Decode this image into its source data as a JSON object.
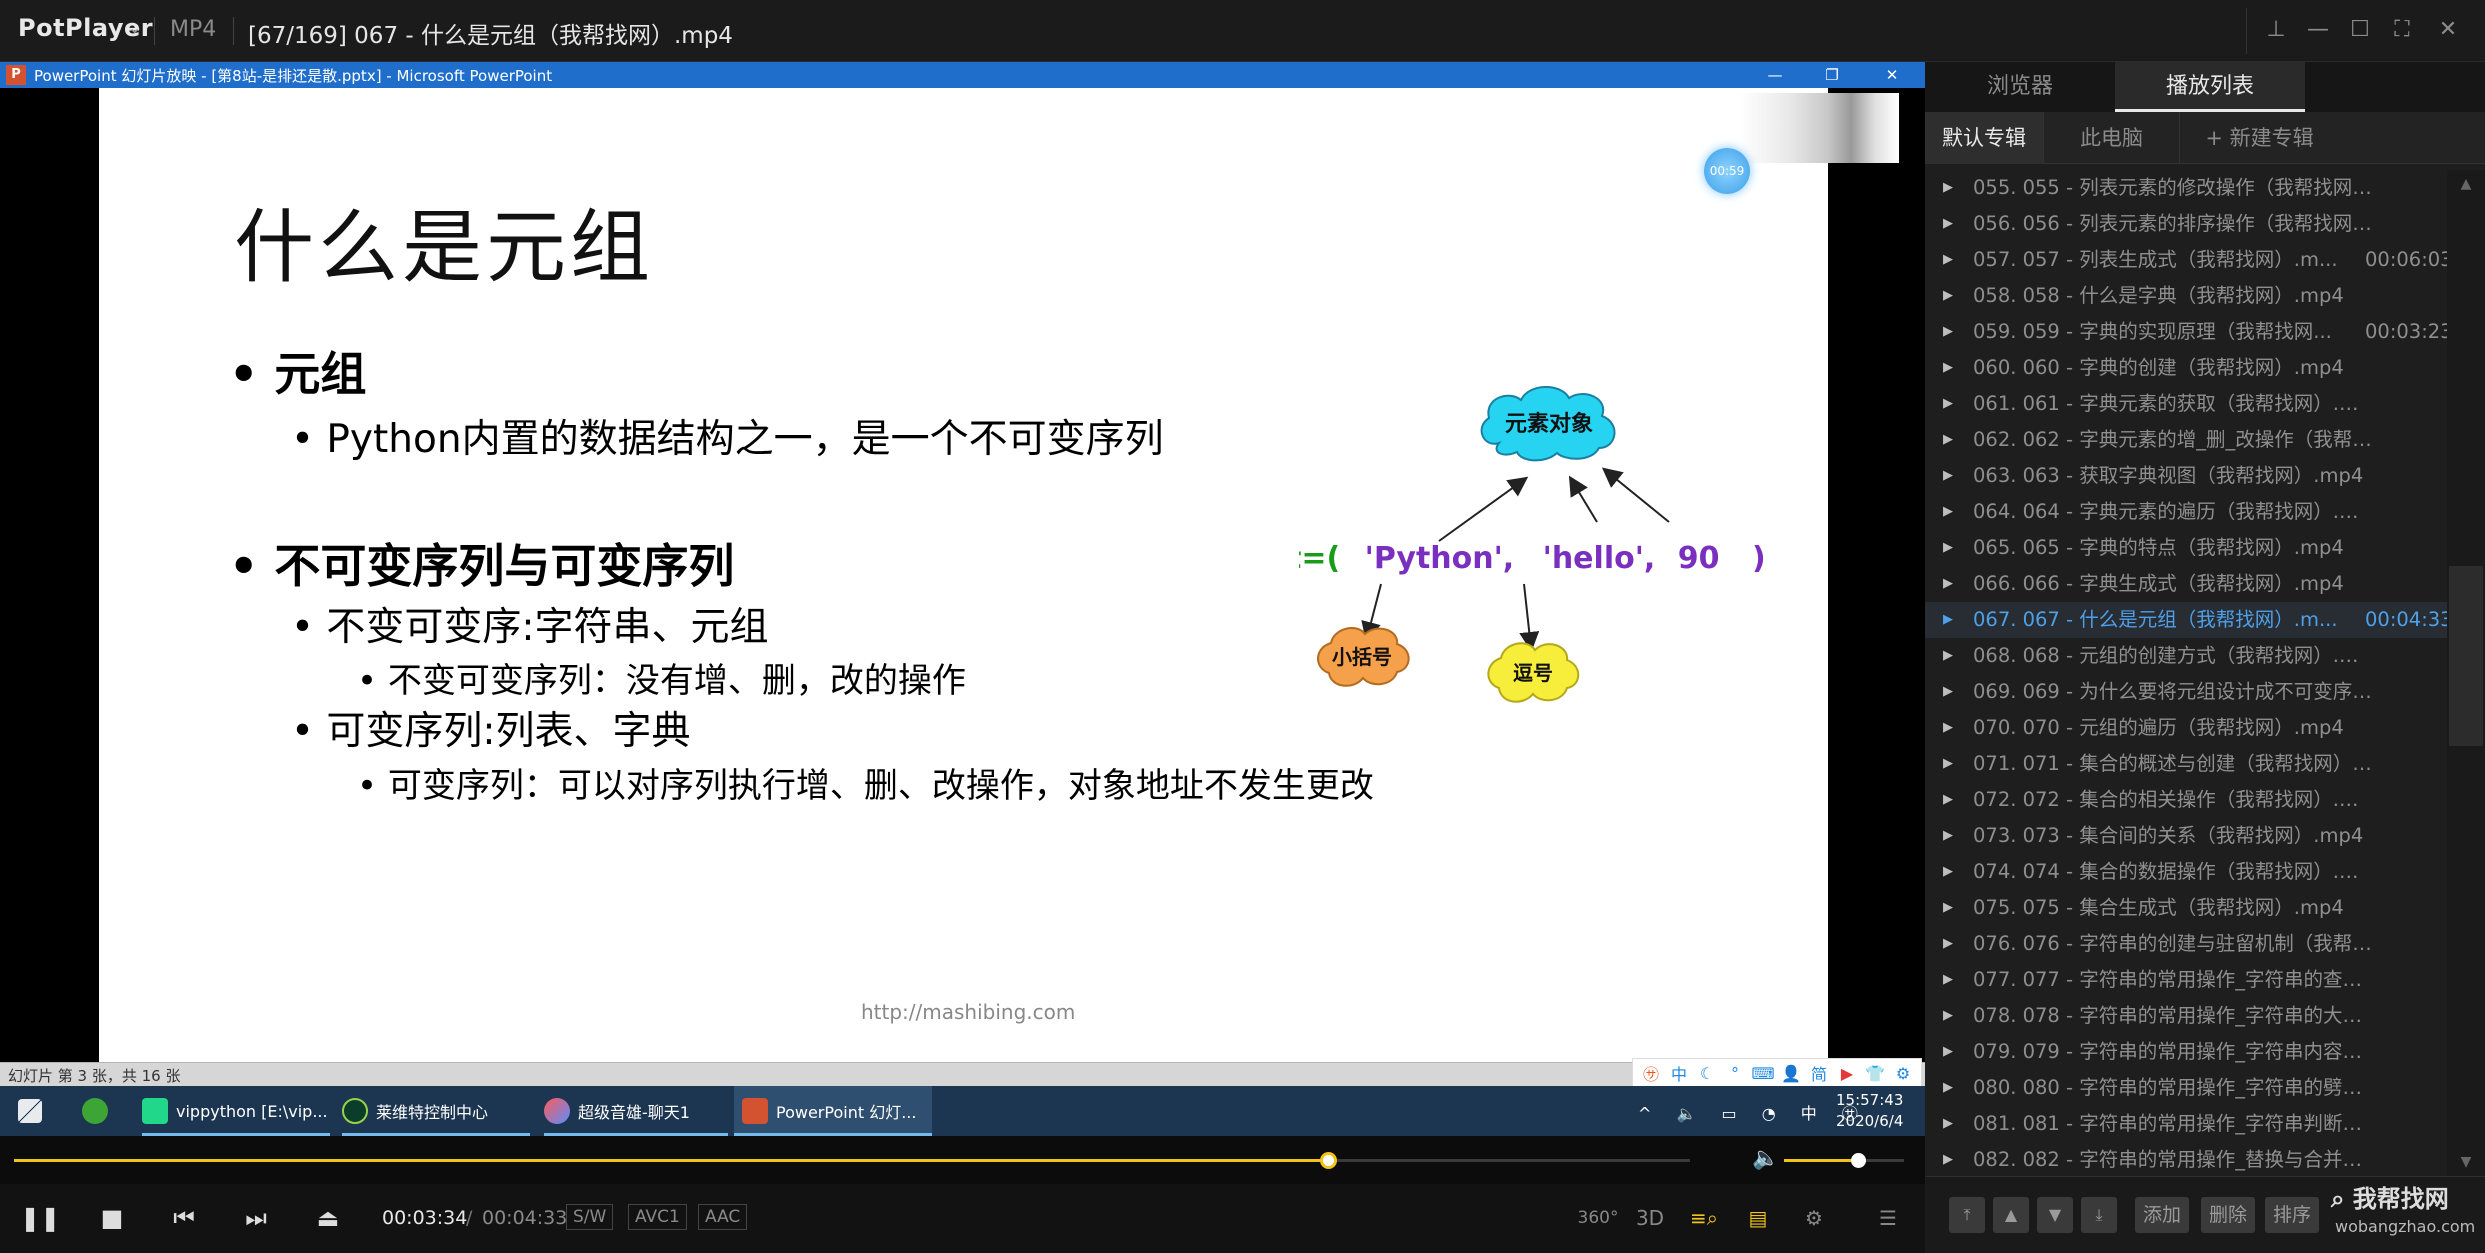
{
  "player": {
    "brand": "PotPlayer",
    "format": "MP4",
    "title": "[67/169] 067 - 什么是元组（我帮找网）.mp4"
  },
  "ppt_window": {
    "title": "PowerPoint 幻灯片放映 - [第8站-是排还是散.pptx] - Microsoft PowerPoint",
    "status": "幻灯片 第 3 张，共 16 张"
  },
  "slide": {
    "title": "什么是元组",
    "timer": "00:59",
    "bullet1": "元组",
    "bullet1_sub": "Python内置的数据结构之一，是一个不可变序列",
    "bullet2": "不可变序列与可变序列",
    "bullet2_sub1": "不变可变序:字符串、元组",
    "bullet2_sub1_detail": "不变可变序列：没有增、删，改的操作",
    "bullet2_sub2": "可变序列:列表、字典",
    "bullet2_sub2_detail": "可变序列：可以对序列执行增、删、改操作，对象地址不发生更改",
    "footer_url": "http://mashibing.com",
    "diagram": {
      "code_prefix": "t=(",
      "code_str1": "'Python',",
      "code_str2": "'hello',",
      "code_num": "90",
      "code_suffix": ")",
      "cloud_elements": "元素对象",
      "cloud_paren": "小括号",
      "cloud_comma": "逗号"
    }
  },
  "taskbar": {
    "items": [
      "vippython [E:\\vip...",
      "莱维特控制中心",
      "超级音雄-聊天1",
      "PowerPoint 幻灯..."
    ],
    "ime_cn": "中",
    "clock_time": "15:57:43",
    "clock_date": "2020/6/4"
  },
  "playback": {
    "current": "00:03:34",
    "separator": "/",
    "total": "00:04:33",
    "progress_fraction": 0.784,
    "volume_fraction": 0.62,
    "tags": [
      "S/W",
      "AVC1",
      "AAC"
    ],
    "btn_360": "360°",
    "btn_3d": "3D"
  },
  "panel": {
    "tabs": [
      "浏览器",
      "播放列表"
    ],
    "subtabs": [
      "默认专辑",
      "此电脑",
      "+ 新建专辑"
    ],
    "items": [
      {
        "name": "055. 055 - 列表元素的修改操作（我帮找网）....",
        "dur": ""
      },
      {
        "name": "056. 056 - 列表元素的排序操作（我帮找网）....",
        "dur": ""
      },
      {
        "name": "057. 057 - 列表生成式（我帮找网）.m...",
        "dur": "00:06:03"
      },
      {
        "name": "058. 058 - 什么是字典（我帮找网）.mp4",
        "dur": ""
      },
      {
        "name": "059. 059 - 字典的实现原理（我帮找网...",
        "dur": "00:03:23"
      },
      {
        "name": "060. 060 - 字典的创建（我帮找网）.mp4",
        "dur": ""
      },
      {
        "name": "061. 061 - 字典元素的获取（我帮找网）.mp4",
        "dur": ""
      },
      {
        "name": "062. 062 - 字典元素的增_删_改操作（我帮找网...",
        "dur": ""
      },
      {
        "name": "063. 063 - 获取字典视图（我帮找网）.mp4",
        "dur": ""
      },
      {
        "name": "064. 064 - 字典元素的遍历（我帮找网）.mp4",
        "dur": ""
      },
      {
        "name": "065. 065 - 字典的特点（我帮找网）.mp4",
        "dur": ""
      },
      {
        "name": "066. 066 - 字典生成式（我帮找网）.mp4",
        "dur": ""
      },
      {
        "name": "067. 067 - 什么是元组（我帮找网）.m...",
        "dur": "00:04:33"
      },
      {
        "name": "068. 068 - 元组的创建方式（我帮找网）.mp4",
        "dur": ""
      },
      {
        "name": "069. 069 - 为什么要将元组设计成不可变序列（...",
        "dur": ""
      },
      {
        "name": "070. 070 - 元组的遍历（我帮找网）.mp4",
        "dur": ""
      },
      {
        "name": "071. 071 - 集合的概述与创建（我帮找网）.mp4",
        "dur": ""
      },
      {
        "name": "072. 072 - 集合的相关操作（我帮找网）.mp4",
        "dur": ""
      },
      {
        "name": "073. 073 - 集合间的关系（我帮找网）.mp4",
        "dur": ""
      },
      {
        "name": "074. 074 - 集合的数据操作（我帮找网）.mp4",
        "dur": ""
      },
      {
        "name": "075. 075 - 集合生成式（我帮找网）.mp4",
        "dur": ""
      },
      {
        "name": "076. 076 - 字符串的创建与驻留机制（我帮找网...",
        "dur": ""
      },
      {
        "name": "077. 077 - 字符串的常用操作_字符串的查询操...",
        "dur": ""
      },
      {
        "name": "078. 078 - 字符串的常用操作_字符串的大小写...",
        "dur": ""
      },
      {
        "name": "079. 079 - 字符串的常用操作_字符串内容对齐...",
        "dur": ""
      },
      {
        "name": "080. 080 - 字符串的常用操作_字符串的劈分（...",
        "dur": ""
      },
      {
        "name": "081. 081 - 字符串的常用操作_字符串判断的相...",
        "dur": ""
      },
      {
        "name": "082. 082 - 字符串的常用操作_替换与合并（我...",
        "dur": ""
      }
    ],
    "active_index": 12,
    "bottom_buttons": [
      "添加",
      "删除",
      "排序"
    ],
    "watermark": "我帮找网",
    "watermark_url": "wobangzhao.com"
  },
  "colors": {
    "accent": "#f0c419",
    "active_item": "#4ea0e8",
    "ppt_blue": "#1f6ecb",
    "taskbar": "#1c3550",
    "code_green": "#1a9b1a",
    "code_purple": "#7b2fbf",
    "cloud_cyan": "#26d4f2",
    "cloud_orange": "#f5a04a",
    "cloud_yellow": "#f6ee3a"
  }
}
